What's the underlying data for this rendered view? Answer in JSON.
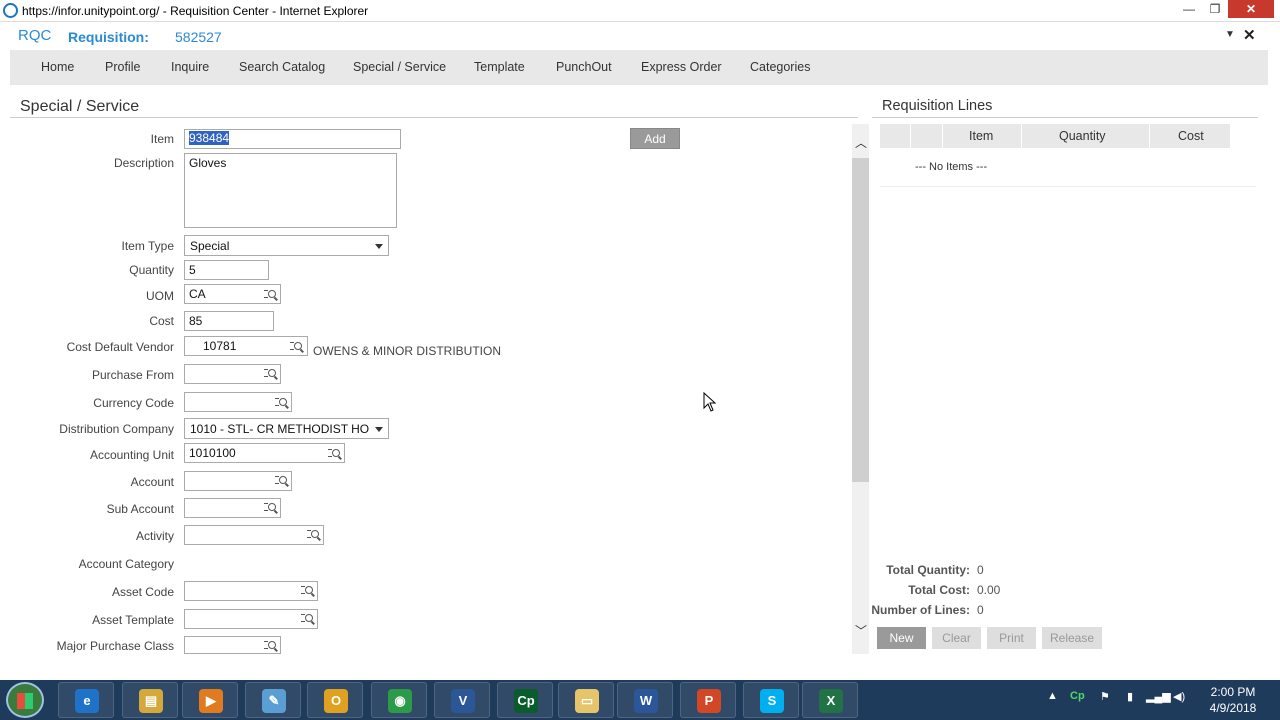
{
  "window": {
    "title": "https://infor.unitypoint.org/ - Requisition Center - Internet Explorer",
    "min_label": "—",
    "max_label": "❐",
    "close_label": "✕"
  },
  "app": {
    "brand": "RQC",
    "req_label": "Requisition:",
    "req_number": "582527",
    "menu_glyph": "▼",
    "close_glyph": "✕"
  },
  "nav": {
    "items": [
      "Home",
      "Profile",
      "Inquire",
      "Search Catalog",
      "Special / Service",
      "Template",
      "PunchOut",
      "Express Order",
      "Categories"
    ]
  },
  "form": {
    "section_title": "Special / Service",
    "add_label": "Add",
    "fields": {
      "item": {
        "label": "Item",
        "value": "938484"
      },
      "description": {
        "label": "Description",
        "value": "Gloves"
      },
      "item_type": {
        "label": "Item Type",
        "value": "Special"
      },
      "quantity": {
        "label": "Quantity",
        "value": "5"
      },
      "uom": {
        "label": "UOM",
        "value": "CA"
      },
      "cost": {
        "label": "Cost",
        "value": "85"
      },
      "vendor": {
        "label": "Cost Default Vendor",
        "value": "10781",
        "name": "OWENS & MINOR DISTRIBUTION"
      },
      "purchase_from": {
        "label": "Purchase From",
        "value": ""
      },
      "currency": {
        "label": "Currency Code",
        "value": ""
      },
      "dist_company": {
        "label": "Distribution Company",
        "value": "1010 - STL- CR METHODIST HO"
      },
      "acct_unit": {
        "label": "Accounting Unit",
        "value": "1010100"
      },
      "account": {
        "label": "Account",
        "value": ""
      },
      "sub_account": {
        "label": "Sub Account",
        "value": ""
      },
      "activity": {
        "label": "Activity",
        "value": ""
      },
      "acct_category": {
        "label": "Account Category",
        "value": ""
      },
      "asset_code": {
        "label": "Asset Code",
        "value": ""
      },
      "asset_template": {
        "label": "Asset Template",
        "value": ""
      },
      "major_purchase": {
        "label": "Major Purchase Class",
        "value": ""
      }
    }
  },
  "lines": {
    "section_title": "Requisition Lines",
    "columns": [
      "Item",
      "Quantity",
      "Cost"
    ],
    "empty_text": "--- No Items ---",
    "total_qty_label": "Total Quantity:",
    "total_qty": "0",
    "total_cost_label": "Total Cost:",
    "total_cost": "0.00",
    "num_lines_label": "Number of Lines:",
    "num_lines": "0",
    "buttons": [
      "New",
      "Clear",
      "Print",
      "Release"
    ]
  },
  "taskbar": {
    "apps": [
      "ie",
      "explorer",
      "media",
      "notes",
      "outlook",
      "chrome",
      "visio",
      "captivate",
      "folder",
      "word",
      "powerpoint",
      "skype",
      "excel"
    ],
    "app_glyphs": [
      "e",
      "▤",
      "▶",
      "✎",
      "O",
      "◉",
      "V",
      "Cp",
      "▭",
      "W",
      "P",
      "S",
      "X"
    ],
    "app_colors": [
      "#1e73c8",
      "#d4a93a",
      "#e07b1f",
      "#5a9fd4",
      "#e0a020",
      "#2b9b4a",
      "#2b5797",
      "#0a5c2c",
      "#e6c46a",
      "#2b579a",
      "#d24726",
      "#00aff0",
      "#217346"
    ],
    "time": "2:00 PM",
    "date": "4/9/2018",
    "tray_glyphs": [
      "▲",
      "Cp",
      "⚑",
      "▮",
      "▂▄▆",
      "◀)"
    ]
  }
}
